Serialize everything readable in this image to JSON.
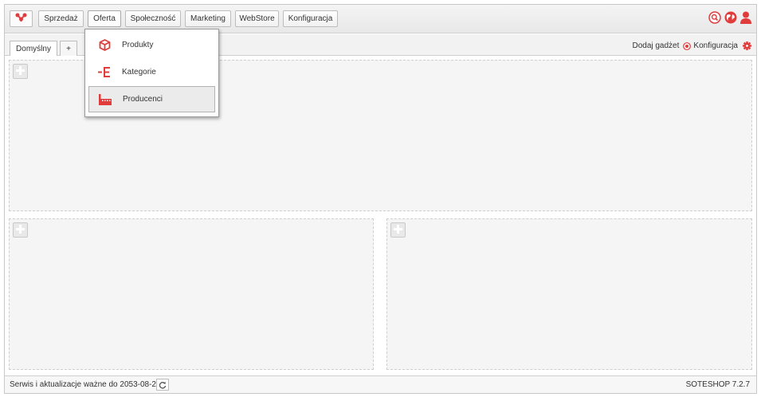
{
  "nav": {
    "items": [
      "Sprzedaż",
      "Oferta",
      "Społeczność",
      "Marketing",
      "WebStore",
      "Konfiguracja"
    ],
    "active": "Oferta"
  },
  "tabs": {
    "default_label": "Domyślny",
    "add_label": "+"
  },
  "toolbar": {
    "add_gadget_label": "Dodaj gadżet",
    "config_label": "Konfiguracja"
  },
  "dropdown": {
    "items": [
      "Produkty",
      "Kategorie",
      "Producenci"
    ],
    "selected": "Producenci"
  },
  "footer": {
    "service_text": "Serwis i aktualizacje ważne do 2053-08-26",
    "version": "SOTESHOP 7.2.7"
  },
  "colors": {
    "accent": "#e03c3c"
  },
  "icons": [
    "logo-icon",
    "search-icon",
    "globe-icon",
    "user-icon",
    "add-circle-icon",
    "gear-icon",
    "cube-icon",
    "category-list-icon",
    "factory-icon",
    "plus-icon",
    "refresh-icon"
  ]
}
